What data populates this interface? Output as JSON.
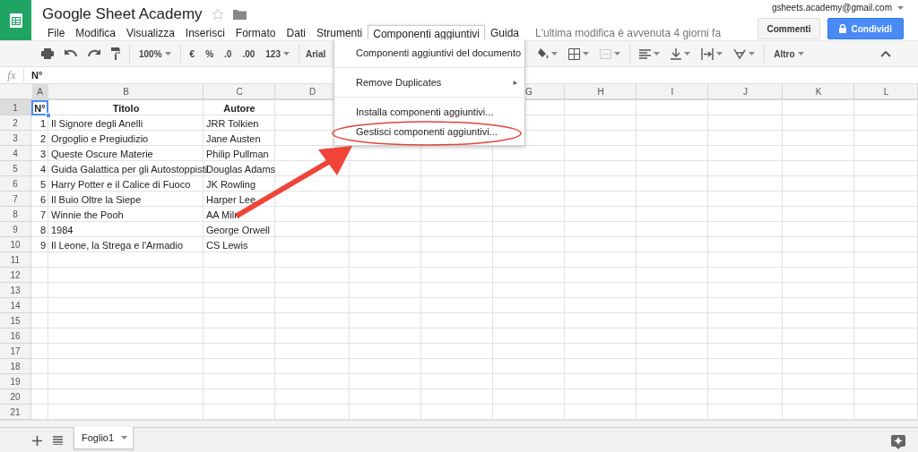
{
  "document": {
    "title": "Google Sheet Academy"
  },
  "menu_bar": [
    {
      "label": "File",
      "selected": false
    },
    {
      "label": "Modifica",
      "selected": false
    },
    {
      "label": "Visualizza",
      "selected": false
    },
    {
      "label": "Inserisci",
      "selected": false
    },
    {
      "label": "Formato",
      "selected": false
    },
    {
      "label": "Dati",
      "selected": false
    },
    {
      "label": "Strumenti",
      "selected": false
    },
    {
      "label": "Componenti aggiuntivi",
      "selected": true
    },
    {
      "label": "Guida",
      "selected": false
    }
  ],
  "last_edit": "L'ultima modifica è avvenuta 4 giorni fa",
  "account": "gsheets.academy@gmail.com",
  "buttons": {
    "comments": "Commenti",
    "share": "Condividi"
  },
  "toolbar": {
    "zoom": "100%",
    "currency": "€",
    "percent": "%",
    "decimal_less": ".0",
    "decimal_more": ".00",
    "number_format": "123",
    "font": "Arial",
    "more": "Altro"
  },
  "formula_bar": {
    "label": "fx",
    "value": "N°"
  },
  "columns": [
    {
      "label": "A",
      "selected": true
    },
    {
      "label": "B",
      "selected": false
    },
    {
      "label": "C",
      "selected": false
    },
    {
      "label": "D",
      "selected": false
    },
    {
      "label": "G",
      "selected": false
    },
    {
      "label": "H",
      "selected": false
    },
    {
      "label": "I",
      "selected": false
    },
    {
      "label": "J",
      "selected": false
    },
    {
      "label": "K",
      "selected": false
    },
    {
      "label": "L",
      "selected": false
    }
  ],
  "header_row": {
    "number": "1",
    "selected": true,
    "cells": [
      "N°",
      "Titolo",
      "Autore"
    ]
  },
  "rows": [
    {
      "number": "2",
      "selected": false,
      "cells": [
        "1",
        "Il Signore degli Anelli",
        "JRR Tolkien"
      ]
    },
    {
      "number": "3",
      "selected": false,
      "cells": [
        "2",
        "Orgoglio e Pregiudizio",
        "Jane Austen"
      ]
    },
    {
      "number": "4",
      "selected": false,
      "cells": [
        "3",
        "Queste Oscure Materie",
        "Philip Pullman"
      ]
    },
    {
      "number": "5",
      "selected": false,
      "cells": [
        "4",
        "Guida Galattica per gli Autostoppisti",
        "Douglas Adams"
      ]
    },
    {
      "number": "6",
      "selected": false,
      "cells": [
        "5",
        "Harry Potter e il Calice di Fuoco",
        "JK Rowling"
      ]
    },
    {
      "number": "7",
      "selected": false,
      "cells": [
        "6",
        "Il Buio Oltre la Siepe",
        "Harper Lee"
      ]
    },
    {
      "number": "8",
      "selected": false,
      "cells": [
        "7",
        "Winnie the Pooh",
        "AA Miln"
      ]
    },
    {
      "number": "9",
      "selected": false,
      "cells": [
        "8",
        "1984",
        "George Orwell"
      ]
    },
    {
      "number": "10",
      "selected": false,
      "cells": [
        "9",
        "Il Leone, la Strega e l'Armadio",
        "CS Lewis"
      ]
    },
    {
      "number": "11",
      "selected": false,
      "cells": []
    },
    {
      "number": "12",
      "selected": false,
      "cells": []
    },
    {
      "number": "13",
      "selected": false,
      "cells": []
    },
    {
      "number": "14",
      "selected": false,
      "cells": []
    },
    {
      "number": "15",
      "selected": false,
      "cells": []
    },
    {
      "number": "16",
      "selected": false,
      "cells": []
    },
    {
      "number": "17",
      "selected": false,
      "cells": []
    },
    {
      "number": "18",
      "selected": false,
      "cells": []
    },
    {
      "number": "19",
      "selected": false,
      "cells": []
    },
    {
      "number": "20",
      "selected": false,
      "cells": []
    },
    {
      "number": "21",
      "selected": false,
      "cells": []
    }
  ],
  "dropdown_menu": [
    {
      "kind": "item",
      "label": "Componenti aggiuntivi del documento"
    },
    {
      "kind": "separator"
    },
    {
      "kind": "submenu",
      "label": "Remove Duplicates",
      "arrow": "►"
    },
    {
      "kind": "separator"
    },
    {
      "kind": "item",
      "label": "Installa componenti aggiuntivi..."
    },
    {
      "kind": "item",
      "label": "Gestisci componenti aggiuntivi..."
    }
  ],
  "sheet_tabs": [
    {
      "label": "Foglio1",
      "selected": true
    }
  ]
}
